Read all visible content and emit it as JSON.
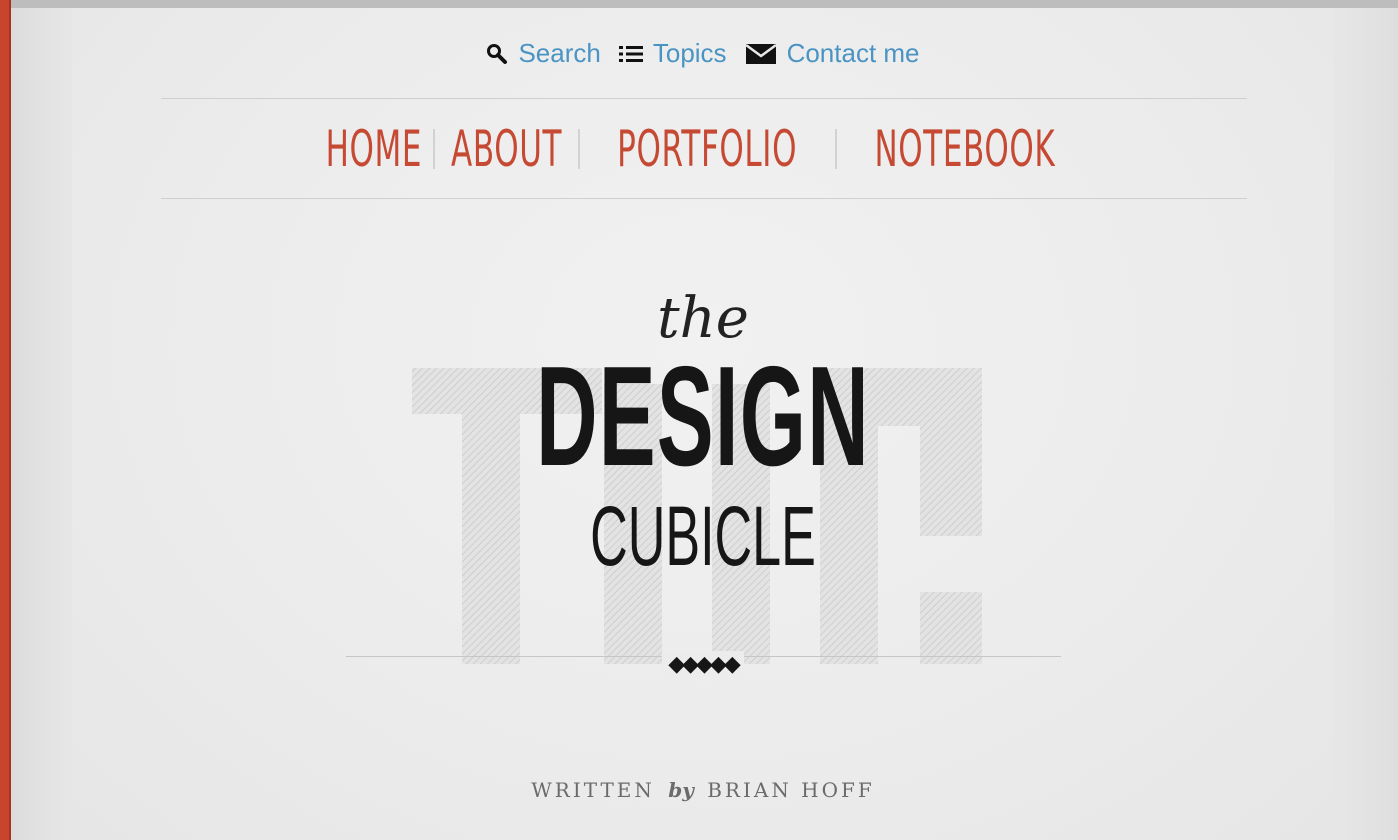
{
  "utility": {
    "search": {
      "label": "Search",
      "icon": "search-icon"
    },
    "topics": {
      "label": "Topics",
      "icon": "list-icon"
    },
    "contact": {
      "label": "Contact me",
      "icon": "envelope-icon"
    }
  },
  "nav": {
    "items": [
      "HOME",
      "ABOUT",
      "PORTFOLIO",
      "NOTEBOOK"
    ]
  },
  "logo": {
    "the": "the",
    "design": "DESIGN",
    "cubicle": "CUBICLE",
    "ornament": "◆◆◆◆◆"
  },
  "byline": {
    "written": "WRITTEN",
    "by": "by",
    "author": "BRIAN HOFF"
  },
  "colors": {
    "accent": "#c64a33",
    "link": "#4a94c4",
    "text_dark": "#161616",
    "edge": "#c9442c"
  }
}
